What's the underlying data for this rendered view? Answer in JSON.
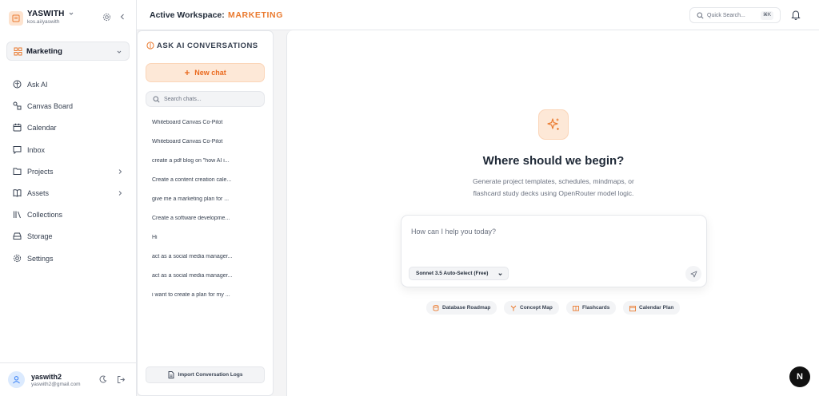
{
  "colors": {
    "accent": "#ea7a2f",
    "accent_soft": "#fde8d7",
    "text": "#1f2937",
    "muted": "#6b7280"
  },
  "workspace": {
    "name": "YASWITH",
    "handle": "kos.ai/yaswith"
  },
  "space_selector": {
    "label": "Marketing",
    "icon": "grid-icon"
  },
  "nav": [
    {
      "label": "Ask AI",
      "icon": "brain-icon"
    },
    {
      "label": "Canvas Board",
      "icon": "canvas-icon"
    },
    {
      "label": "Calendar",
      "icon": "calendar-icon"
    },
    {
      "label": "Inbox",
      "icon": "message-icon"
    },
    {
      "label": "Projects",
      "icon": "folder-icon",
      "has_submenu": true
    },
    {
      "label": "Assets",
      "icon": "book-icon",
      "has_submenu": true
    },
    {
      "label": "Collections",
      "icon": "library-icon"
    },
    {
      "label": "Storage",
      "icon": "storage-icon"
    },
    {
      "label": "Settings",
      "icon": "gear-icon"
    }
  ],
  "user": {
    "name": "yaswith2",
    "email": "yaswith2@gmail.com"
  },
  "topbar": {
    "label": "Active Workspace:",
    "workspace": "MARKETING",
    "search_placeholder": "Quick Search...",
    "shortcut": "⌘K"
  },
  "conversations": {
    "title": "ASK AI CONVERSATIONS",
    "new_chat": "New chat",
    "search_placeholder": "Search chats...",
    "items": [
      "Whiteboard Canvas Co-Pilot",
      "Whiteboard Canvas Co-Pilot",
      "create a pdf blog on \"how AI i...",
      "Create a content creation cale...",
      "give me a marketing plan for ...",
      "Create a software developme...",
      "Hi",
      "act as a social media manager...",
      "act as a social media manager...",
      "i want to create a plan for my ..."
    ],
    "import_label": "Import Conversation Logs"
  },
  "hero": {
    "title": "Where should we begin?",
    "subtitle_line1": "Generate project templates, schedules, mindmaps, or",
    "subtitle_line2": "flashcard study decks using OpenRouter model logic."
  },
  "prompt": {
    "placeholder": "How can I help you today?",
    "model": "Sonnet 3.5 Auto-Select (Free)"
  },
  "chips": [
    {
      "label": "Database Roadmap",
      "icon": "database-icon"
    },
    {
      "label": "Concept Map",
      "icon": "branch-icon"
    },
    {
      "label": "Flashcards",
      "icon": "cards-icon"
    },
    {
      "label": "Calendar Plan",
      "icon": "calendar-icon"
    }
  ],
  "badge": "N"
}
